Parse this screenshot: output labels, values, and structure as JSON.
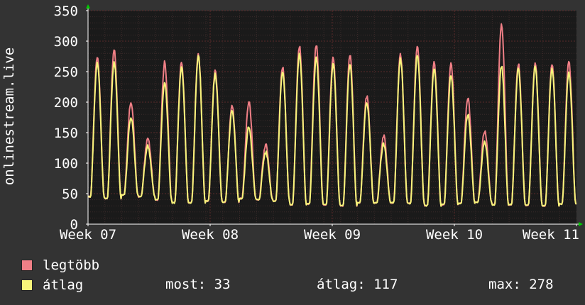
{
  "chart_data": {
    "type": "line",
    "ylabel": "onlinestream.live",
    "ylim": [
      0,
      350
    ],
    "yticks": [
      0,
      50,
      100,
      150,
      200,
      250,
      300,
      350
    ],
    "xticks": [
      "Week 07",
      "Week 08",
      "Week 09",
      "Week 10",
      "Week 11"
    ],
    "grid": true,
    "legend_placement": "bottom-left",
    "colors": {
      "background": "#333333",
      "plot_background": "#1a1a1a",
      "grid": "#5a2a2a",
      "axis": "#ffffff",
      "arrow": "#00cc00",
      "max_series": "#f07f86",
      "avg_series": "#f7f47a"
    },
    "series": [
      {
        "name": "legtöbb",
        "color": "#f07f86",
        "daily_peaks": [
          275,
          285,
          200,
          140,
          265,
          265,
          278,
          250,
          195,
          200,
          130,
          258,
          292,
          295,
          275,
          278,
          210,
          145,
          277,
          290,
          265,
          265,
          208,
          153,
          328,
          263,
          262,
          262,
          265
        ],
        "daily_troughs": [
          45,
          42,
          48,
          45,
          40,
          35,
          35,
          38,
          36,
          42,
          40,
          38,
          32,
          33,
          32,
          30,
          35,
          35,
          35,
          34,
          30,
          32,
          34,
          36,
          32,
          32,
          31,
          30,
          33
        ]
      },
      {
        "name": "átlag",
        "color": "#f7f47a",
        "daily_peaks": [
          265,
          265,
          175,
          128,
          232,
          257,
          275,
          245,
          185,
          160,
          118,
          250,
          280,
          272,
          262,
          262,
          200,
          132,
          270,
          277,
          255,
          245,
          180,
          135,
          260,
          255,
          258,
          255,
          248
        ],
        "daily_troughs": [
          45,
          42,
          48,
          45,
          40,
          35,
          35,
          38,
          36,
          42,
          40,
          38,
          32,
          33,
          32,
          30,
          35,
          35,
          35,
          34,
          30,
          32,
          34,
          36,
          32,
          32,
          31,
          30,
          33
        ]
      }
    ]
  },
  "legend": {
    "max_label": "legtöbb",
    "avg_label": "átlag"
  },
  "stats": {
    "current": "most: 33",
    "average": "átlag: 117",
    "maximum": "max: 278"
  }
}
